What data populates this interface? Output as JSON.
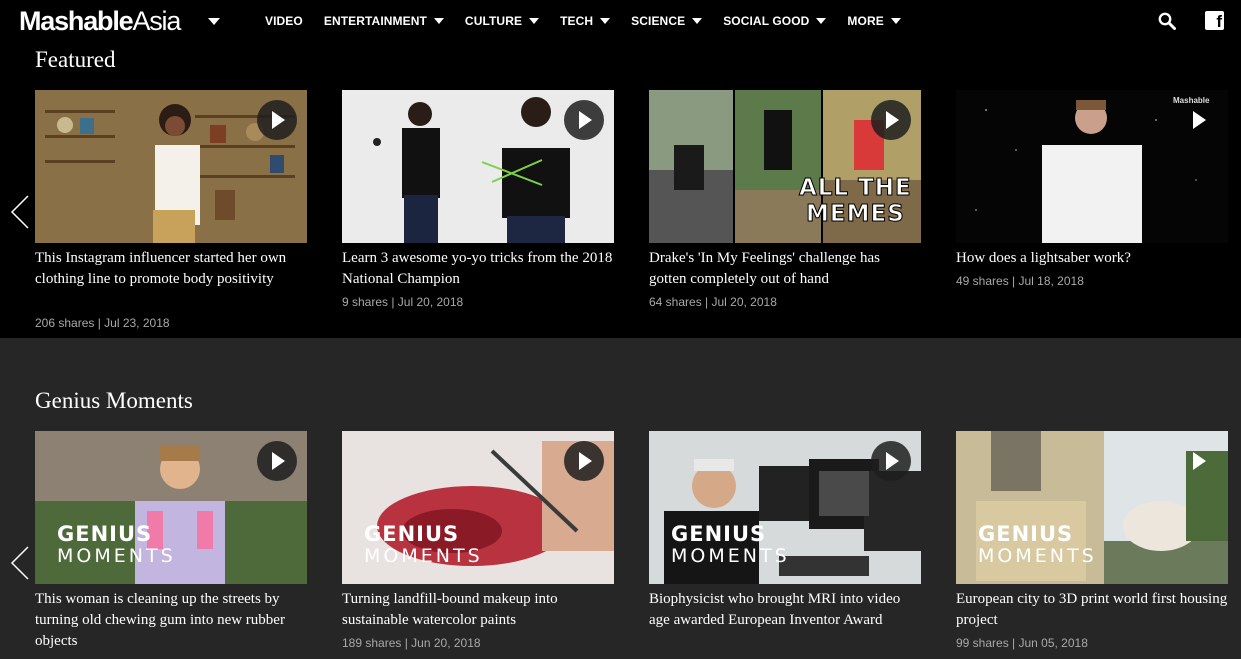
{
  "nav": {
    "logo_bold": "Mashable",
    "logo_light": "Asia",
    "items": [
      {
        "label": "VIDEO",
        "dropdown": false
      },
      {
        "label": "ENTERTAINMENT",
        "dropdown": true
      },
      {
        "label": "CULTURE",
        "dropdown": true
      },
      {
        "label": "TECH",
        "dropdown": true
      },
      {
        "label": "SCIENCE",
        "dropdown": true
      },
      {
        "label": "SOCIAL GOOD",
        "dropdown": true
      },
      {
        "label": "MORE",
        "dropdown": true
      }
    ],
    "icons": [
      "search-icon",
      "facebook-icon"
    ],
    "facebook_glyph": "f"
  },
  "featured": {
    "title": "Featured",
    "cards": [
      {
        "title": "This Instagram influencer started her own clothing line to promote body positivity",
        "meta": "206 shares | Jul 23, 2018"
      },
      {
        "title": "Learn 3 awesome yo-yo tricks from the 2018 National Champion",
        "meta": "9 shares | Jul 20, 2018"
      },
      {
        "title": "Drake's 'In My Feelings' challenge has gotten completely out of hand",
        "meta": "64 shares | Jul 20, 2018",
        "overlay_line1": "ALL THE",
        "overlay_line2": "MEMES"
      },
      {
        "title": "How does a lightsaber work?",
        "meta": "49 shares | Jul 18, 2018",
        "watermark": "Mashable"
      }
    ]
  },
  "genius": {
    "title": "Genius Moments",
    "badge_line1": "GENIUS",
    "badge_line2": "MOMENTS",
    "cards": [
      {
        "title": "This woman is cleaning up the streets by turning old chewing gum into new rubber objects",
        "meta": ""
      },
      {
        "title": "Turning landfill-bound makeup into sustainable watercolor paints",
        "meta": "189 shares | Jun 20, 2018"
      },
      {
        "title": "Biophysicist who brought MRI into video age awarded European Inventor Award",
        "meta": ""
      },
      {
        "title": "European city to 3D print world first housing project",
        "meta": "99 shares | Jun 05, 2018"
      }
    ]
  },
  "colors": {
    "page_bg": "#000000",
    "genius_bg": "#262626",
    "meta_text": "#a9a9a9"
  }
}
